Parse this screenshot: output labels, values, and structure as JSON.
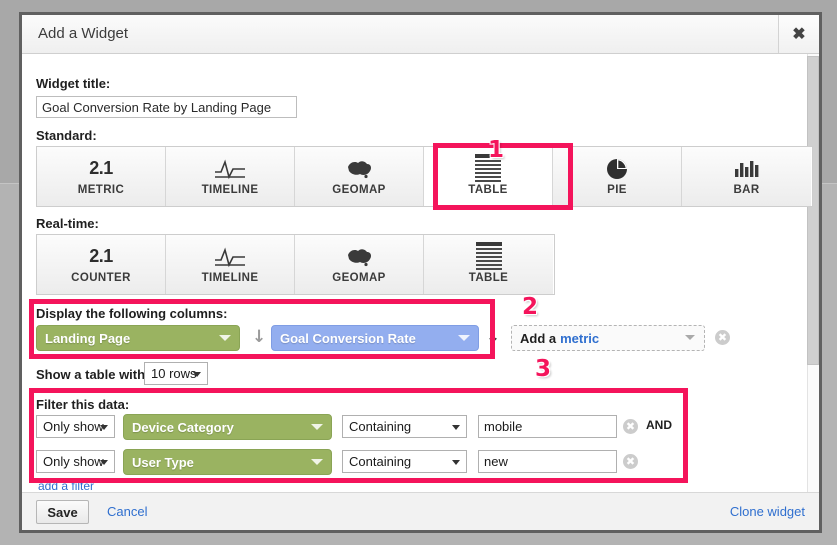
{
  "dialog": {
    "title": "Add a Widget",
    "close_icon": "close-icon"
  },
  "widget_title": {
    "label": "Widget title:",
    "value": "Goal Conversion Rate by Landing Page"
  },
  "standard": {
    "label": "Standard:",
    "types": [
      {
        "label": "METRIC",
        "icon": "number-2-1-icon",
        "glyph": "2.1",
        "selected": false
      },
      {
        "label": "TIMELINE",
        "icon": "timeline-icon",
        "glyph": "",
        "selected": false
      },
      {
        "label": "GEOMAP",
        "icon": "geomap-icon",
        "glyph": "",
        "selected": false
      },
      {
        "label": "TABLE",
        "icon": "table-icon",
        "glyph": "",
        "selected": true
      },
      {
        "label": "PIE",
        "icon": "pie-chart-icon",
        "glyph": "",
        "selected": false
      },
      {
        "label": "BAR",
        "icon": "bar-chart-icon",
        "glyph": "",
        "selected": false
      }
    ]
  },
  "realtime": {
    "label": "Real-time:",
    "types": [
      {
        "label": "COUNTER",
        "icon": "number-2-1-icon",
        "glyph": "2.1"
      },
      {
        "label": "TIMELINE",
        "icon": "timeline-icon",
        "glyph": ""
      },
      {
        "label": "GEOMAP",
        "icon": "geomap-icon",
        "glyph": ""
      },
      {
        "label": "TABLE",
        "icon": "table-icon",
        "glyph": ""
      }
    ]
  },
  "columns": {
    "label": "Display the following columns:",
    "dimension": "Landing Page",
    "metric": "Goal Conversion Rate",
    "add_metric_prefix": "Add a",
    "add_metric_link": "metric",
    "remove_icon": "remove-circle-icon",
    "sort_icon": "sort-arrow-down-icon"
  },
  "rows": {
    "prefix": "Show a table with",
    "value": "10 rows"
  },
  "filters": {
    "label": "Filter this data:",
    "conjunction": "AND",
    "add_filter": "add a filter",
    "rows": [
      {
        "mode": "Only show",
        "field": "Device Category",
        "operator": "Containing",
        "value": "mobile",
        "remove_icon": "remove-circle-icon"
      },
      {
        "mode": "Only show",
        "field": "User Type",
        "operator": "Containing",
        "value": "new",
        "remove_icon": "remove-circle-icon"
      }
    ]
  },
  "footer": {
    "save": "Save",
    "cancel": "Cancel",
    "clone": "Clone widget"
  },
  "annotations": {
    "one": "1",
    "two": "2",
    "three": "3"
  },
  "colors": {
    "accent_pink": "#f4145b",
    "dimension_green": "#9ab361",
    "metric_blue": "#93aeef",
    "link_blue": "#2f6fcf"
  }
}
